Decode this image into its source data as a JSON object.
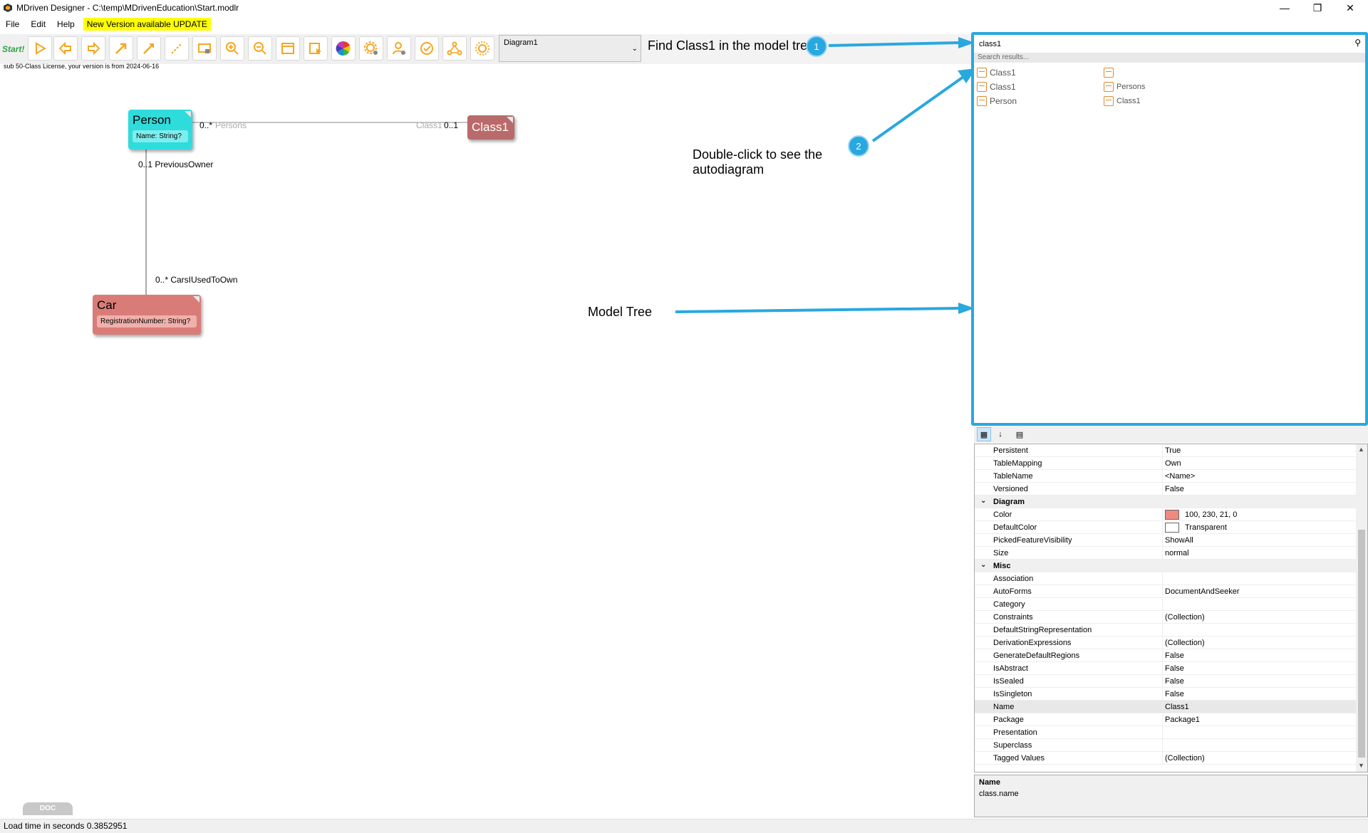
{
  "window": {
    "title": "MDriven Designer - C:\\temp\\MDrivenEducation\\Start.modlr"
  },
  "menu": {
    "file": "File",
    "edit": "Edit",
    "help": "Help",
    "update": "New Version available UPDATE"
  },
  "toolbar": {
    "start": "Start!",
    "diagram_value": "Diagram1"
  },
  "license": "sub 50-Class License, your version is from 2024-06-16",
  "annotations": {
    "find": "Find Class1 in the model tree",
    "double_click": "Double-click to see the autodiagram",
    "model_tree": "Model Tree",
    "badge1": "1",
    "badge2": "2"
  },
  "diagram": {
    "person": {
      "name": "Person",
      "attr": "Name: String?",
      "color": "#2fdcdc"
    },
    "class1": {
      "name": "Class1",
      "color": "#b96b6b"
    },
    "car": {
      "name": "Car",
      "attr": "RegistrationNumber: String?",
      "color": "#d97c78"
    },
    "roles": {
      "persons_mult": "0..*",
      "persons": "Persons",
      "class1_role": "Class1",
      "class1_mult": "0..1",
      "prev_owner": "0..1 PreviousOwner",
      "cars_used": "0..* CarsIUsedToOwn"
    }
  },
  "tree": {
    "search_value": "class1",
    "search_results": "Search results...",
    "left_items": [
      "Class1",
      "Class1",
      "Person"
    ],
    "right_items": [
      "",
      "Persons",
      "Class1"
    ]
  },
  "properties": [
    {
      "name": "Persistent",
      "value": "True"
    },
    {
      "name": "TableMapping",
      "value": "Own"
    },
    {
      "name": "TableName",
      "value": "<Name>"
    },
    {
      "name": "Versioned",
      "value": "False"
    },
    {
      "category": "Diagram"
    },
    {
      "name": "Color",
      "value": "100, 230, 21, 0",
      "swatch": "#f08a80"
    },
    {
      "name": "DefaultColor",
      "value": "Transparent",
      "swatch": "#ffffff"
    },
    {
      "name": "PickedFeatureVisibility",
      "value": "ShowAll"
    },
    {
      "name": "Size",
      "value": "normal"
    },
    {
      "category": "Misc"
    },
    {
      "name": "Association",
      "value": ""
    },
    {
      "name": "AutoForms",
      "value": "DocumentAndSeeker"
    },
    {
      "name": "Category",
      "value": ""
    },
    {
      "name": "Constraints",
      "value": "(Collection)"
    },
    {
      "name": "DefaultStringRepresentation",
      "value": ""
    },
    {
      "name": "DerivationExpressions",
      "value": "(Collection)"
    },
    {
      "name": "GenerateDefaultRegions",
      "value": "False"
    },
    {
      "name": "IsAbstract",
      "value": "False"
    },
    {
      "name": "IsSealed",
      "value": "False"
    },
    {
      "name": "IsSingleton",
      "value": "False"
    },
    {
      "name": "Name",
      "value": "Class1",
      "selected": true
    },
    {
      "name": "Package",
      "value": "Package1"
    },
    {
      "name": "Presentation",
      "value": ""
    },
    {
      "name": "Superclass",
      "value": ""
    },
    {
      "name": "Tagged Values",
      "value": "(Collection)"
    }
  ],
  "description": {
    "name": "Name",
    "text": "class.name"
  },
  "doc_tab": "DOC",
  "status": "Load time in seconds 0.3852951",
  "colors": {
    "accent": "#29a8df",
    "tool_orange": "#f5a623"
  }
}
